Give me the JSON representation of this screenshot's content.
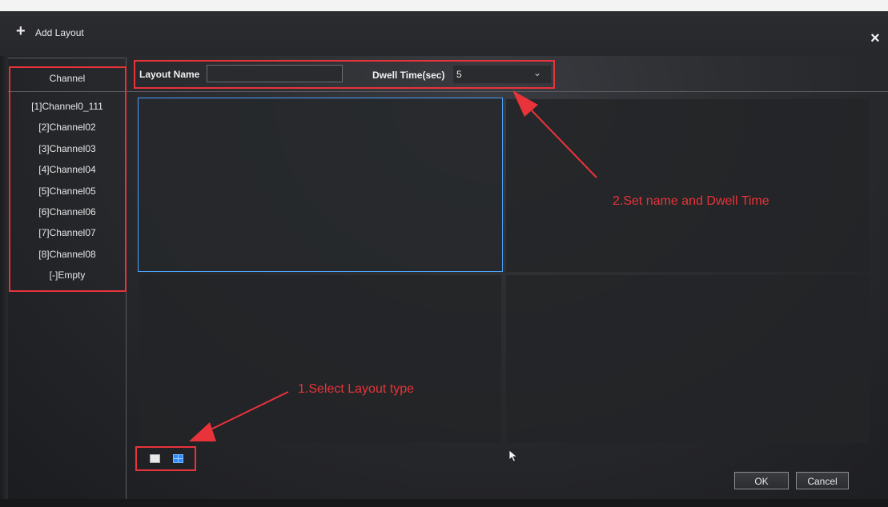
{
  "window": {
    "title": "Add Layout",
    "close_symbol": "×"
  },
  "channel_panel": {
    "header": "Channel",
    "items": [
      {
        "label": "[1]Channel0_111"
      },
      {
        "label": "[2]Channel02"
      },
      {
        "label": "[3]Channel03"
      },
      {
        "label": "[4]Channel04"
      },
      {
        "label": "[5]Channel05"
      },
      {
        "label": "[6]Channel06"
      },
      {
        "label": "[7]Channel07"
      },
      {
        "label": "[8]Channel08"
      },
      {
        "label": "[-]Empty"
      }
    ]
  },
  "form": {
    "layout_name_label": "Layout Name",
    "layout_name_value": "",
    "dwell_time_label": "Dwell Time(sec)",
    "dwell_time_value": "5"
  },
  "layout_types": {
    "options": [
      "single-view",
      "quad-view"
    ],
    "selected": "quad-view"
  },
  "preview": {
    "selected_cell": 1
  },
  "footer": {
    "ok_label": "OK",
    "cancel_label": "Cancel"
  },
  "annotations": {
    "step1_text": "1.Select Layout type",
    "step2_text": "2.Set name and Dwell Time"
  },
  "colors": {
    "annotation_red": "#e8333a",
    "selection_blue": "#4aa3ff",
    "layout_quad_active": "#2f8bff"
  },
  "icons": {
    "add": "plus-icon",
    "close": "close-icon",
    "dropdown": "chevron-down-icon",
    "pointer": "mouse-cursor-icon"
  }
}
